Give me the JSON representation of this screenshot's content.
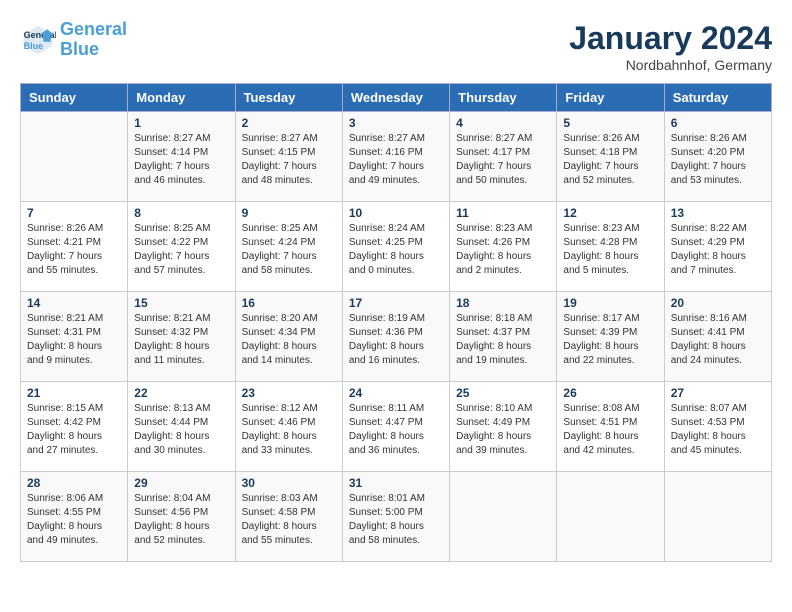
{
  "header": {
    "title": "January 2024",
    "location": "Nordbahnhof, Germany",
    "logo_line1": "General",
    "logo_line2": "Blue"
  },
  "days_of_week": [
    "Sunday",
    "Monday",
    "Tuesday",
    "Wednesday",
    "Thursday",
    "Friday",
    "Saturday"
  ],
  "weeks": [
    [
      {
        "day": "",
        "info": ""
      },
      {
        "day": "1",
        "info": "Sunrise: 8:27 AM\nSunset: 4:14 PM\nDaylight: 7 hours\nand 46 minutes."
      },
      {
        "day": "2",
        "info": "Sunrise: 8:27 AM\nSunset: 4:15 PM\nDaylight: 7 hours\nand 48 minutes."
      },
      {
        "day": "3",
        "info": "Sunrise: 8:27 AM\nSunset: 4:16 PM\nDaylight: 7 hours\nand 49 minutes."
      },
      {
        "day": "4",
        "info": "Sunrise: 8:27 AM\nSunset: 4:17 PM\nDaylight: 7 hours\nand 50 minutes."
      },
      {
        "day": "5",
        "info": "Sunrise: 8:26 AM\nSunset: 4:18 PM\nDaylight: 7 hours\nand 52 minutes."
      },
      {
        "day": "6",
        "info": "Sunrise: 8:26 AM\nSunset: 4:20 PM\nDaylight: 7 hours\nand 53 minutes."
      }
    ],
    [
      {
        "day": "7",
        "info": "Sunrise: 8:26 AM\nSunset: 4:21 PM\nDaylight: 7 hours\nand 55 minutes."
      },
      {
        "day": "8",
        "info": "Sunrise: 8:25 AM\nSunset: 4:22 PM\nDaylight: 7 hours\nand 57 minutes."
      },
      {
        "day": "9",
        "info": "Sunrise: 8:25 AM\nSunset: 4:24 PM\nDaylight: 7 hours\nand 58 minutes."
      },
      {
        "day": "10",
        "info": "Sunrise: 8:24 AM\nSunset: 4:25 PM\nDaylight: 8 hours\nand 0 minutes."
      },
      {
        "day": "11",
        "info": "Sunrise: 8:23 AM\nSunset: 4:26 PM\nDaylight: 8 hours\nand 2 minutes."
      },
      {
        "day": "12",
        "info": "Sunrise: 8:23 AM\nSunset: 4:28 PM\nDaylight: 8 hours\nand 5 minutes."
      },
      {
        "day": "13",
        "info": "Sunrise: 8:22 AM\nSunset: 4:29 PM\nDaylight: 8 hours\nand 7 minutes."
      }
    ],
    [
      {
        "day": "14",
        "info": "Sunrise: 8:21 AM\nSunset: 4:31 PM\nDaylight: 8 hours\nand 9 minutes."
      },
      {
        "day": "15",
        "info": "Sunrise: 8:21 AM\nSunset: 4:32 PM\nDaylight: 8 hours\nand 11 minutes."
      },
      {
        "day": "16",
        "info": "Sunrise: 8:20 AM\nSunset: 4:34 PM\nDaylight: 8 hours\nand 14 minutes."
      },
      {
        "day": "17",
        "info": "Sunrise: 8:19 AM\nSunset: 4:36 PM\nDaylight: 8 hours\nand 16 minutes."
      },
      {
        "day": "18",
        "info": "Sunrise: 8:18 AM\nSunset: 4:37 PM\nDaylight: 8 hours\nand 19 minutes."
      },
      {
        "day": "19",
        "info": "Sunrise: 8:17 AM\nSunset: 4:39 PM\nDaylight: 8 hours\nand 22 minutes."
      },
      {
        "day": "20",
        "info": "Sunrise: 8:16 AM\nSunset: 4:41 PM\nDaylight: 8 hours\nand 24 minutes."
      }
    ],
    [
      {
        "day": "21",
        "info": "Sunrise: 8:15 AM\nSunset: 4:42 PM\nDaylight: 8 hours\nand 27 minutes."
      },
      {
        "day": "22",
        "info": "Sunrise: 8:13 AM\nSunset: 4:44 PM\nDaylight: 8 hours\nand 30 minutes."
      },
      {
        "day": "23",
        "info": "Sunrise: 8:12 AM\nSunset: 4:46 PM\nDaylight: 8 hours\nand 33 minutes."
      },
      {
        "day": "24",
        "info": "Sunrise: 8:11 AM\nSunset: 4:47 PM\nDaylight: 8 hours\nand 36 minutes."
      },
      {
        "day": "25",
        "info": "Sunrise: 8:10 AM\nSunset: 4:49 PM\nDaylight: 8 hours\nand 39 minutes."
      },
      {
        "day": "26",
        "info": "Sunrise: 8:08 AM\nSunset: 4:51 PM\nDaylight: 8 hours\nand 42 minutes."
      },
      {
        "day": "27",
        "info": "Sunrise: 8:07 AM\nSunset: 4:53 PM\nDaylight: 8 hours\nand 45 minutes."
      }
    ],
    [
      {
        "day": "28",
        "info": "Sunrise: 8:06 AM\nSunset: 4:55 PM\nDaylight: 8 hours\nand 49 minutes."
      },
      {
        "day": "29",
        "info": "Sunrise: 8:04 AM\nSunset: 4:56 PM\nDaylight: 8 hours\nand 52 minutes."
      },
      {
        "day": "30",
        "info": "Sunrise: 8:03 AM\nSunset: 4:58 PM\nDaylight: 8 hours\nand 55 minutes."
      },
      {
        "day": "31",
        "info": "Sunrise: 8:01 AM\nSunset: 5:00 PM\nDaylight: 8 hours\nand 58 minutes."
      },
      {
        "day": "",
        "info": ""
      },
      {
        "day": "",
        "info": ""
      },
      {
        "day": "",
        "info": ""
      }
    ]
  ]
}
